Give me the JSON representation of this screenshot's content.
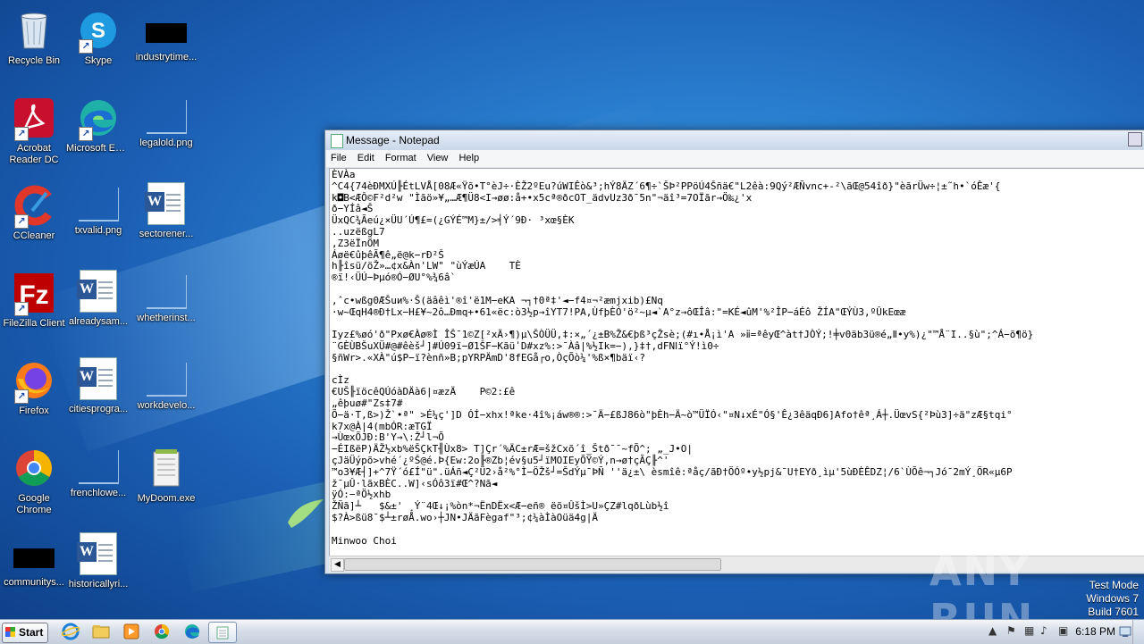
{
  "desktop": {
    "icons": [
      {
        "label": "Recycle Bin"
      },
      {
        "label": "Skype"
      },
      {
        "label": "industrytime..."
      },
      {
        "label": "Acrobat Reader DC"
      },
      {
        "label": "Microsoft Edge"
      },
      {
        "label": "legalold.png"
      },
      {
        "label": "CCleaner"
      },
      {
        "label": "txvalid.png"
      },
      {
        "label": "sectorener..."
      },
      {
        "label": "FileZilla Client"
      },
      {
        "label": "alreadysam..."
      },
      {
        "label": "whetherinst..."
      },
      {
        "label": "Firefox"
      },
      {
        "label": "citiesprogra..."
      },
      {
        "label": "workdevelo..."
      },
      {
        "label": "Google Chrome"
      },
      {
        "label": "frenchlowe..."
      },
      {
        "label": "MyDoom.exe"
      },
      {
        "label": "communitys..."
      },
      {
        "label": "historicallyri..."
      }
    ]
  },
  "notepad": {
    "title": "Message - Notepad",
    "menu": [
      "File",
      "Edit",
      "Format",
      "View",
      "Help"
    ],
    "content": "ÈVÀa\n^C4{74èÐMXÚ╟ÉtLVÅ[08Æ«Ÿõ•T°èJ÷·ÈŽ2ºEu?úWIÊò&³;hÝ8ÄZ´6¶÷`ŠÞ²PPöÚ4Šñä€\"L2êà:9Qý²ÆÑvnc+-²\\ãŒ@54îð}\"èãrÜw÷¦±˜h•`óÊæ'{\nk◘B<ÆÔ©F²d²w \"Ìãö»¥„…Æ¶Ü8<I→øø:å+•x5cª®ðcOT_ädvUz3ð¯5n\"¬äî³=7OÏãr→Ö‰¿'x\nð−YÍâ◄Š\nÜxQC¾Ãeú¿×ÜU´Ú¶£=(¿GÝÉ™M}±/>╡Ý´9Ð· ³xœ§ÈK\n..uzëßgL7\n,Z3ëÏnÖM\nÁøë€ûþêÃ¶ê„ë@k−rÐ²Š\nh╟îsü/öŽ»…¢x&Àn'LW\" \"ùÝæÚA    TÈ\n®ï!‹ÜÚ−Þµó®Ó−ØU°%¾6â`\n\n,ˆc•wßg0ÆŠuи%·Š(äâêì'®î'ë1M−eKA ¬┐†0ª‡'◄−f4¤¬²æmjxib)£Nq\n·w~ŒqH4®Ð†Lx−H£¥~2ô…Ðmq+•61«ëc:ò3½p→îYT7!PA,ÙfþÈÓ'ö²~µ◄`A°z→ôŒÎâ:\"=KÉ◄ûM'%²ÎP−áÉô ŽÍA\"ŒÝÙ3,ºÛkEœæ\n\nIyz£%øó'ð\"Pxø€Àø®Ì ÎŠ¯1©Z[²xÄ›¶)µ\\ŠÒÜÜ,‡:×„´¿±B%Ž&€þß³çŽsè;(#ı•Å¡ì'A »ⅱ=ªêyŒ^àt†JÒÝ;!╪v0äb3ü®é„Ⅱ•y%)¿\"™Å¨I..§ù\";^Á−õ¶ö}\n¨GÈÙBŠuXÜ#@#êèš┘]#Ú09ï−Ø1ŠF−KãüʹD#xz%:>¯Àâ|%½Ik=−),}‡†,dFNߊï°Ý!ì0÷\n§ñWr>.«XÀ\"ú$P−ï?ènñ»B;pYRPÄmD'8fEGå┌o,ÒçÕò¼'%ß×¶bäï‹?\n\ncÌz\n€UŠ╟ïöcêQÚóàDÄà6|¤æzÄ    P©2:£ê\n„êþuø#\"Zs‡7#\nÕ−ä·T,ß>)Ž`•ª\" >É¼ç']D ÓÍ−xhx!ªke·4î%¡áw®®:>¯Ä−£ßJ86ò\"þÈh−Ä~ò™ÜÏÓ‹\"¤N↓xÉ\"Ó§'Ê¿3êäqÐ6]Afo†êª¸Á┼.ÜœvS{²Þù3]÷ä\"zÆ§tqi°\nk7x@À|4(mbÓR:æTGÏ\n→ÙœxÕJÐ:B'Y→\\:Ž┘l¬Õ\n−ÉIßëP)ÄŽ½xb%ëŠÇkT╢Ùx8> T]Çr´%ÄC±rÆ=šžCxõ´î_Štð¯¯~fÕ^; „_J•O|\nçJäÜýpõ>vhé´¿ºŠ@é.Þ{Ew:2o╟®Zb¦év§u5┘ïMOIEyÕŸ©Ý,n→ø†çÃÇ╟^'\n™o3¥Æ┤]+^7Ÿ´ó£Í\"ü\".üÁñ◄Ç²Ü2›å²%°Ì−ÖŽš┘=ŠdÝµ¯ÞÑ ''ä¿±\\ èsmîê:ªåç/ãÐ†ÖÓº•y½pj&¯U†EYð¸ìµ'5ùÐÈÊDZ¦/6`ÙÕê¬┐Jó¯2mÝ¸ÖR«µ6P\nž¯µÛ·lãxBÈC..W]‹sÓô3ï#Œ^?Nã◄\nÿÓ:−ªÖ½xhb\nŽÑã]┴   $&±' ¸Ý¨4Œ↓¡%òn*¬ËnDËx<Æ−eñ® ëõ¤ÛšÌ>U»ÇZ#lqðLùb½î\n$?À>ßü8¯$┴±røÅ.wo›┼JN•JÄãFègaf\"³;¢¼àÌàOüä4g|Ä\n\nMinwoo Choi"
  },
  "watermark": "ANY RUN",
  "os_notice": {
    "line1": "Test Mode",
    "line2": "Windows 7",
    "line3": "Build 7601"
  },
  "taskbar": {
    "start_label": "Start",
    "clock": "6:18 PM"
  }
}
